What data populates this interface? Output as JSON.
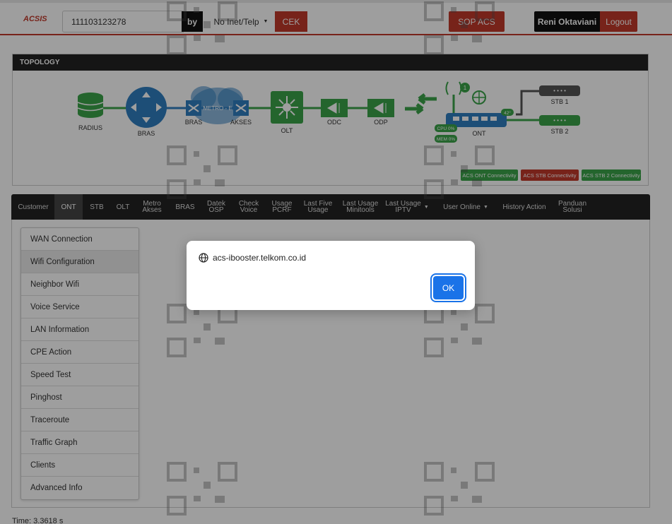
{
  "header": {
    "logo": "ACSIS",
    "search_value": "111103123278",
    "by_label": "by",
    "type_select": "No Inet/Telp",
    "cek_label": "CEK",
    "sop_label": "SOP ACS",
    "user_name": "Reni Oktaviani",
    "logout_label": "Logout"
  },
  "topology": {
    "title": "TOPOLOGY",
    "nodes": {
      "radius": "RADIUS",
      "bras": "BRAS",
      "bras2": "BRAS",
      "metro": "METRO - E",
      "akses": "AKSES",
      "olt": "OLT",
      "odc": "ODC",
      "odp": "ODP",
      "ont": "ONT",
      "stb1": "STB 1",
      "stb2": "STB 2"
    },
    "cpu": "CPU 0%",
    "mem": "MEM 0%",
    "temp": "42°",
    "wifi_count": "1",
    "badges": [
      {
        "label": "ACS ONT Connectivity",
        "color": "#3aa34a"
      },
      {
        "label": "ACS STB Connectivity",
        "color": "#c0392b"
      },
      {
        "label": "ACS STB 2 Connectivity",
        "color": "#3aa34a"
      }
    ]
  },
  "tabs": [
    {
      "label": "Customer"
    },
    {
      "label": "ONT"
    },
    {
      "label": "STB"
    },
    {
      "label": "OLT"
    },
    {
      "label": "Metro\nAkses"
    },
    {
      "label": "BRAS"
    },
    {
      "label": "Datek\nOSP"
    },
    {
      "label": "Check\nVoice"
    },
    {
      "label": "Usage\nPCRF"
    },
    {
      "label": "Last Five\nUsage"
    },
    {
      "label": "Last Usage\nMinitools"
    },
    {
      "label": "Last Usage\nIPTV"
    },
    {
      "label": "User Online"
    },
    {
      "label": "History Action"
    },
    {
      "label": "Panduan\nSolusi"
    }
  ],
  "menu": [
    "WAN Connection",
    "Wifi Configuration",
    "Neighbor Wifi",
    "Voice Service",
    "LAN Information",
    "CPE Action",
    "Speed Test",
    "Pinghost",
    "Traceroute",
    "Traffic Graph",
    "Clients",
    "Advanced Info"
  ],
  "timing": "Time: 3.3618 s",
  "dialog": {
    "origin": "acs-ibooster.telkom.co.id",
    "ok_label": "OK"
  },
  "colors": {
    "accent_red": "#c0392b",
    "topo_green": "#3aa34a",
    "topo_blue": "#2f7fc1",
    "dialog_blue": "#1a73e8"
  }
}
